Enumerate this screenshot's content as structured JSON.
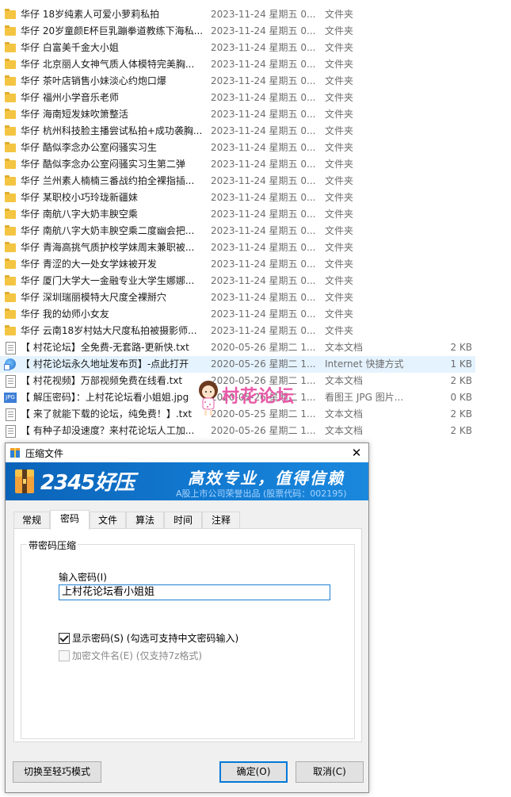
{
  "explorer": {
    "rows": [
      {
        "icon": "folder",
        "name": "华仔 18岁纯素人可爱小萝莉私拍",
        "date": "2023-11-24 星期五 0...",
        "type": "文件夹",
        "size": ""
      },
      {
        "icon": "folder",
        "name": "华仔 20岁童颜E杯巨乳蹦拳道教练下海私...",
        "date": "2023-11-24 星期五 0...",
        "type": "文件夹",
        "size": ""
      },
      {
        "icon": "folder",
        "name": "华仔 白富美千金大小姐",
        "date": "2023-11-24 星期五 0...",
        "type": "文件夹",
        "size": ""
      },
      {
        "icon": "folder",
        "name": "华仔 北京丽人女神气质人体模特完美胸...",
        "date": "2023-11-24 星期五 0...",
        "type": "文件夹",
        "size": ""
      },
      {
        "icon": "folder",
        "name": "华仔 茶叶店销售小妹淡心约炮口爆",
        "date": "2023-11-24 星期五 0...",
        "type": "文件夹",
        "size": ""
      },
      {
        "icon": "folder",
        "name": "华仔 福州小学音乐老师",
        "date": "2023-11-24 星期五 0...",
        "type": "文件夹",
        "size": ""
      },
      {
        "icon": "folder",
        "name": "华仔 海南短发妹吹箫整活",
        "date": "2023-11-24 星期五 0...",
        "type": "文件夹",
        "size": ""
      },
      {
        "icon": "folder",
        "name": "华仔 杭州科技脸主播尝试私拍+成功袭胸...",
        "date": "2023-11-24 星期五 0...",
        "type": "文件夹",
        "size": ""
      },
      {
        "icon": "folder",
        "name": "华仔 酷似李念办公室闷骚实习生",
        "date": "2023-11-24 星期五 0...",
        "type": "文件夹",
        "size": ""
      },
      {
        "icon": "folder",
        "name": "华仔 酷似李念办公室闷骚实习生第二弹",
        "date": "2023-11-24 星期五 0...",
        "type": "文件夹",
        "size": ""
      },
      {
        "icon": "folder",
        "name": "华仔 兰州素人楠楠三番战约拍全裸指插...",
        "date": "2023-11-24 星期五 0...",
        "type": "文件夹",
        "size": ""
      },
      {
        "icon": "folder",
        "name": "华仔 某职校小巧玲珑新疆妹",
        "date": "2023-11-24 星期五 0...",
        "type": "文件夹",
        "size": ""
      },
      {
        "icon": "folder",
        "name": "华仔 南航八字大奶丰腴空乘",
        "date": "2023-11-24 星期五 0...",
        "type": "文件夹",
        "size": ""
      },
      {
        "icon": "folder",
        "name": "华仔 南航八字大奶丰腴空乘二度幽会把...",
        "date": "2023-11-24 星期五 0...",
        "type": "文件夹",
        "size": ""
      },
      {
        "icon": "folder",
        "name": "华仔 青海高挑气质护校学妹周末兼职被...",
        "date": "2023-11-24 星期五 0...",
        "type": "文件夹",
        "size": ""
      },
      {
        "icon": "folder",
        "name": "华仔 青涩的大一处女学妹被开发",
        "date": "2023-11-24 星期五 0...",
        "type": "文件夹",
        "size": ""
      },
      {
        "icon": "folder",
        "name": "华仔 厦门大学大一金融专业大学生娜娜...",
        "date": "2023-11-24 星期五 0...",
        "type": "文件夹",
        "size": ""
      },
      {
        "icon": "folder",
        "name": "华仔 深圳瑞丽模特大尺度全裸掰穴",
        "date": "2023-11-24 星期五 0...",
        "type": "文件夹",
        "size": ""
      },
      {
        "icon": "folder",
        "name": "华仔 我的幼师小女友",
        "date": "2023-11-24 星期五 0...",
        "type": "文件夹",
        "size": ""
      },
      {
        "icon": "folder",
        "name": "华仔 云南18岁村姑大尺度私拍被摄影师...",
        "date": "2023-11-24 星期五 0...",
        "type": "文件夹",
        "size": ""
      },
      {
        "icon": "text",
        "name": "【 村花论坛】全免费-无套路-更新快.txt",
        "date": "2020-05-26 星期二 1...",
        "type": "文本文档",
        "size": "2 KB"
      },
      {
        "icon": "url",
        "name": "【 村花论坛永久地址发布页】-点此打开",
        "date": "2020-05-26 星期二 1...",
        "type": "Internet 快捷方式",
        "size": "1 KB"
      },
      {
        "icon": "text",
        "name": "【 村花视频】万部视频免费在线看.txt",
        "date": "2020-05-26 星期二 1...",
        "type": "文本文档",
        "size": "2 KB"
      },
      {
        "icon": "jpg",
        "name": "【 解压密码】：上村花论坛看小姐姐.jpg",
        "date": "2020-05-26 星期二 1...",
        "type": "看图王 JPG 图片...",
        "size": "0 KB"
      },
      {
        "icon": "text",
        "name": "【 来了就能下载的论坛，纯免费！】.txt",
        "date": "2020-05-25 星期二 1...",
        "type": "文本文档",
        "size": "2 KB"
      },
      {
        "icon": "text",
        "name": "【 有种子却没速度？来村花论坛人工加...",
        "date": "2020-05-26 星期二 1...",
        "type": "文本文档",
        "size": "2 KB"
      }
    ],
    "selected_index": 21,
    "jpg_icon_label": "JPG"
  },
  "watermark": {
    "text": "村花论坛"
  },
  "dialog": {
    "title": "压缩文件",
    "close_glyph": "✕",
    "banner": {
      "brand": "2345好压",
      "slogan": "高效专业，值得信赖",
      "subtitle": "A股上市公司荣誉出品 (股票代码：002195)"
    },
    "tabs": [
      {
        "label": "常规",
        "active": false
      },
      {
        "label": "密码",
        "active": true
      },
      {
        "label": "文件",
        "active": false
      },
      {
        "label": "算法",
        "active": false
      },
      {
        "label": "时间",
        "active": false
      },
      {
        "label": "注释",
        "active": false
      }
    ],
    "group_title": "带密码压缩",
    "password_label": "输入密码(I)",
    "password_value": "上村花论坛看小姐姐",
    "show_password": {
      "label": "显示密码(S) (勾选可支持中文密码输入)",
      "checked": true
    },
    "encrypt_names": {
      "label": "加密文件名(E) (仅支持7z格式)",
      "checked": false,
      "disabled": true
    },
    "buttons": {
      "lite_mode": "切换至轻巧模式",
      "ok": "确定(O)",
      "cancel": "取消(C)"
    }
  },
  "colors": {
    "folder": "#f4c542",
    "selection": "#e5f3ff",
    "banner": "#1279d0",
    "accent": "#0078d7",
    "watermark": "#e95aa8"
  }
}
